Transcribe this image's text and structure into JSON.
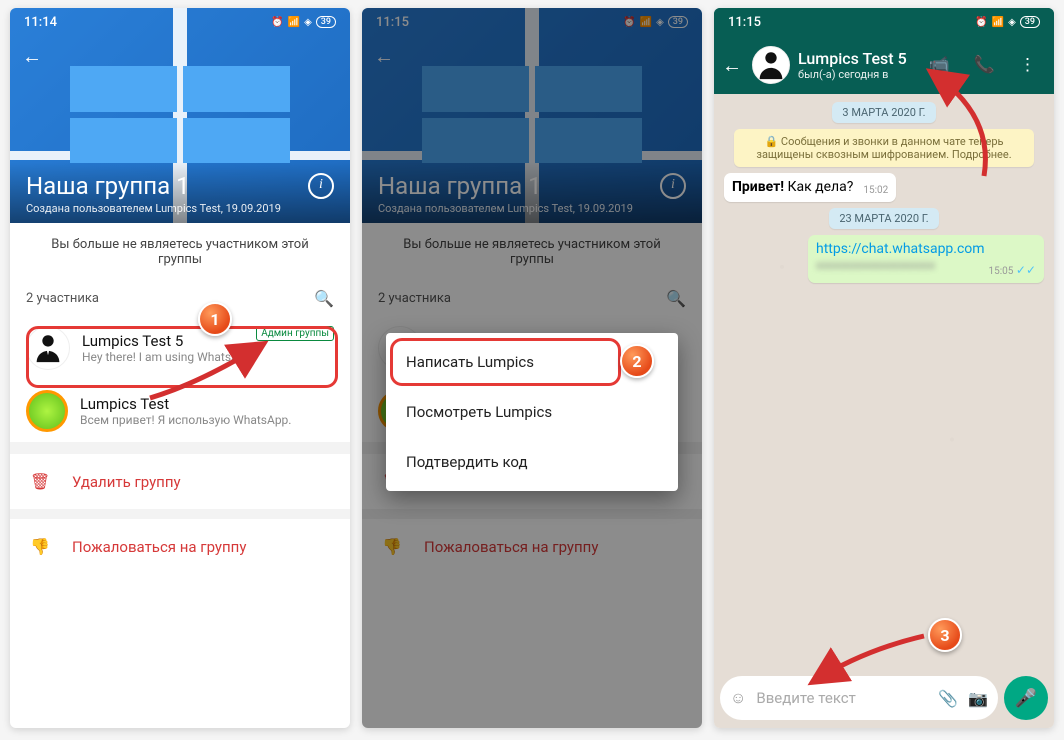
{
  "status": {
    "t1": "11:14",
    "t2": "11:15",
    "t3": "11:15",
    "batt": "39"
  },
  "group": {
    "title": "Наша группа 1",
    "subtitle": "Создана пользователем Lumpics Test, 19.09.2019",
    "not_member": "Вы больше не являетесь участником этой группы",
    "members_header": "2 участника"
  },
  "members": [
    {
      "name": "Lumpics Test 5",
      "status": "Hey there! I am using WhatsApp.",
      "admin": "Админ группы"
    },
    {
      "name": "Lumpics Test",
      "status": "Всем привет! Я использую WhatsApp."
    }
  ],
  "actions": {
    "delete": "Удалить группу",
    "report": "Пожаловаться на группу"
  },
  "popup": {
    "write": "Написать Lumpics",
    "view": "Посмотреть Lumpics",
    "confirm": "Подтвердить код"
  },
  "chat": {
    "title": "Lumpics Test 5",
    "sub": "был(-а) сегодня в",
    "date1": "3 МАРТА 2020 Г.",
    "enc": "Сообщения и звонки в данном чате теперь защищены сквозным шифрованием. Подробнее.",
    "msg1_strong": "Привет!",
    "msg1_rest": " Как дела?",
    "msg1_time": "15:02",
    "date2": "23 МАРТА 2020 Г.",
    "msg2_link": "https://chat.whatsapp.com",
    "msg2_time": "15:05",
    "placeholder": "Введите текст"
  },
  "badges": {
    "b1": "1",
    "b2": "2",
    "b3": "3"
  }
}
